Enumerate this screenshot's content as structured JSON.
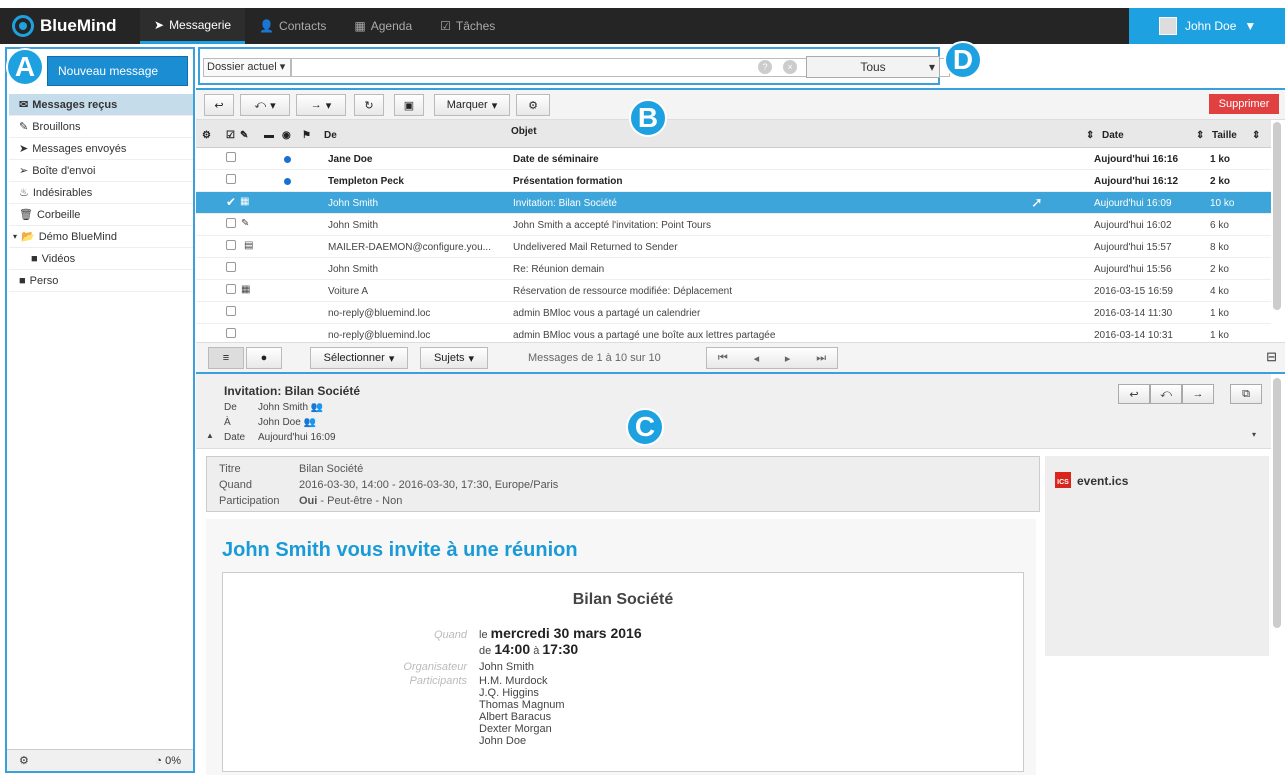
{
  "app": {
    "name": "BlueMind"
  },
  "nav": {
    "tabs": [
      {
        "label": "Messagerie",
        "icon": "paper-plane-icon"
      },
      {
        "label": "Contacts",
        "icon": "user-icon"
      },
      {
        "label": "Agenda",
        "icon": "calendar-icon"
      },
      {
        "label": "Tâches",
        "icon": "checklist-icon"
      }
    ],
    "user": "John Doe"
  },
  "callouts": {
    "a": "A",
    "b": "B",
    "c": "C",
    "d": "D"
  },
  "sidebar": {
    "new_message": "Nouveau message",
    "folders": [
      "Messages reçus",
      "Brouillons",
      "Messages envoyés",
      "Boîte d'envoi",
      "Indésirables",
      "Corbeille",
      "Démo BlueMind",
      "Vidéos",
      "Perso"
    ],
    "quota": "0%"
  },
  "search": {
    "scope": "Dossier actuel",
    "filter": "Tous"
  },
  "toolbar": {
    "mark": "Marquer",
    "delete": "Supprimer"
  },
  "columns": {
    "from": "De",
    "subject": "Objet",
    "date": "Date",
    "size": "Taille"
  },
  "messages": [
    {
      "from": "Jane Doe",
      "subject": "Date de séminaire",
      "date": "Aujourd'hui 16:16",
      "size": "1 ko"
    },
    {
      "from": "Templeton Peck",
      "subject": "Présentation formation",
      "date": "Aujourd'hui 16:12",
      "size": "2 ko"
    },
    {
      "from": "John Smith",
      "subject": "Invitation: Bilan Société",
      "date": "Aujourd'hui 16:09",
      "size": "10 ko"
    },
    {
      "from": "John Smith",
      "subject": "John Smith a accepté l'invitation: Point Tours",
      "date": "Aujourd'hui 16:02",
      "size": "6 ko"
    },
    {
      "from": "MAILER-DAEMON@configure.you...",
      "subject": "Undelivered Mail Returned to Sender",
      "date": "Aujourd'hui 15:57",
      "size": "8 ko"
    },
    {
      "from": "John Smith",
      "subject": "Re: Réunion demain",
      "date": "Aujourd'hui 15:56",
      "size": "2 ko"
    },
    {
      "from": "Voiture A",
      "subject": "Réservation de ressource modifiée: Déplacement",
      "date": "2016-03-15 16:59",
      "size": "4 ko"
    },
    {
      "from": "no-reply@bluemind.loc",
      "subject": "admin BMloc vous a partagé un calendrier",
      "date": "2016-03-14 11:30",
      "size": "1 ko"
    },
    {
      "from": "no-reply@bluemind.loc",
      "subject": "admin BMloc vous a partagé une boîte aux lettres partagée",
      "date": "2016-03-14 10:31",
      "size": "1 ko"
    }
  ],
  "listfooter": {
    "select": "Sélectionner",
    "threads": "Sujets",
    "count": "Messages de 1 à 10 sur 10"
  },
  "message": {
    "subject": "Invitation: Bilan Société",
    "from_label": "De",
    "from": "John Smith",
    "to_label": "À",
    "to": "John Doe",
    "date_label": "Date",
    "date": "Aujourd'hui 16:09",
    "inv": {
      "title_label": "Titre",
      "title": "Bilan Société",
      "when_label": "Quand",
      "when": "2016-03-30, 14:00 - 2016-03-30, 17:30, Europe/Paris",
      "part_label": "Participation",
      "yes": "Oui",
      "rest": " - Peut-être - Non"
    },
    "attachment": "event.ics",
    "headline": "John Smith vous invite à une réunion",
    "card": {
      "title": "Bilan Société",
      "when_label": "Quand",
      "le": "le",
      "date": "mercredi 30 mars 2016",
      "de": "de",
      "start": "14:00",
      "a": "à",
      "end": "17:30",
      "org_label": "Organisateur",
      "organizer": "John Smith",
      "part_label": "Participants",
      "participants": [
        "H.M. Murdock",
        "J.Q. Higgins",
        "Thomas Magnum",
        "Albert Baracus",
        "Dexter Morgan",
        "John Doe"
      ]
    }
  }
}
